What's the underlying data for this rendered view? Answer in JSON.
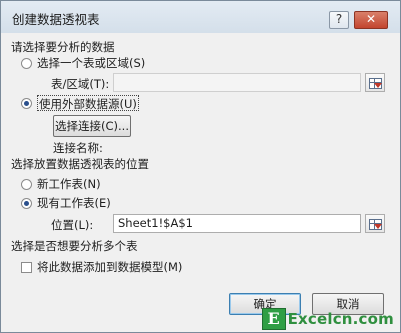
{
  "window": {
    "title": "创建数据透视表",
    "help_label": "?",
    "close_label": "✕"
  },
  "data_source": {
    "section_label": "请选择要分析的数据",
    "option_table": "选择一个表或区域(S)",
    "table_range_label": "表/区域(T):",
    "table_range_value": "",
    "option_external": "使用外部数据源(U)",
    "choose_connection_label": "选择连接(C)...",
    "connection_name_label": "连接名称:",
    "selected_option": "external"
  },
  "placement": {
    "section_label": "选择放置数据透视表的位置",
    "option_new_sheet": "新工作表(N)",
    "option_existing_sheet": "现有工作表(E)",
    "location_label": "位置(L):",
    "location_value": "Sheet1!$A$1",
    "selected_option": "existing"
  },
  "multiple_tables": {
    "section_label": "选择是否想要分析多个表",
    "add_to_model_label": "将此数据添加到数据模型(M)",
    "add_to_model_checked": false
  },
  "buttons": {
    "ok_label": "确定",
    "cancel_label": "取消"
  },
  "watermark": {
    "logo_letter": "E",
    "text": "Excelcn.com"
  },
  "icons": {
    "range_picker": "range-picker-icon"
  }
}
